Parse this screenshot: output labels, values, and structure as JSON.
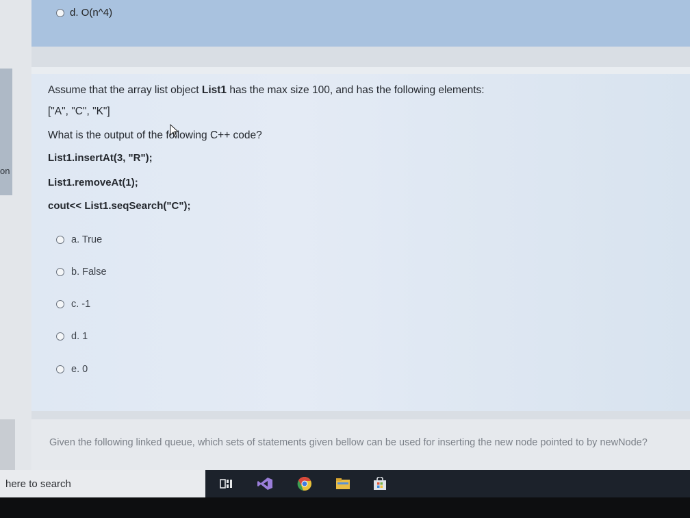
{
  "previous_question": {
    "option_d": "d. O(n^4)"
  },
  "left_cut_text": "on",
  "question": {
    "line1_pre": "Assume that the array list object ",
    "line1_bold": "List1",
    "line1_post": " has the max size 100, and has the following elements:",
    "elements": "[\"A\", \"C\", \"K\"]",
    "prompt": "What is the output of the following C++ code?",
    "code": [
      "List1.insertAt(3, \"R\");",
      "List1.removeAt(1);",
      "cout<< List1.seqSearch(\"C\");"
    ],
    "options": [
      "a. True",
      "b. False",
      "c. -1",
      "d. 1",
      "e. 0"
    ]
  },
  "next_question": {
    "text": "Given the following linked queue, which sets of statements given bellow can be used for inserting the new node pointed to by newNode?"
  },
  "taskbar": {
    "search_placeholder": "here to search",
    "icons": [
      "task-view-icon",
      "visual-studio-icon",
      "chrome-icon",
      "file-explorer-icon",
      "store-icon"
    ]
  },
  "colors": {
    "top_panel": "#a9c2df",
    "main_panel": "#dfe8f3",
    "taskbar": "#1c222b"
  }
}
